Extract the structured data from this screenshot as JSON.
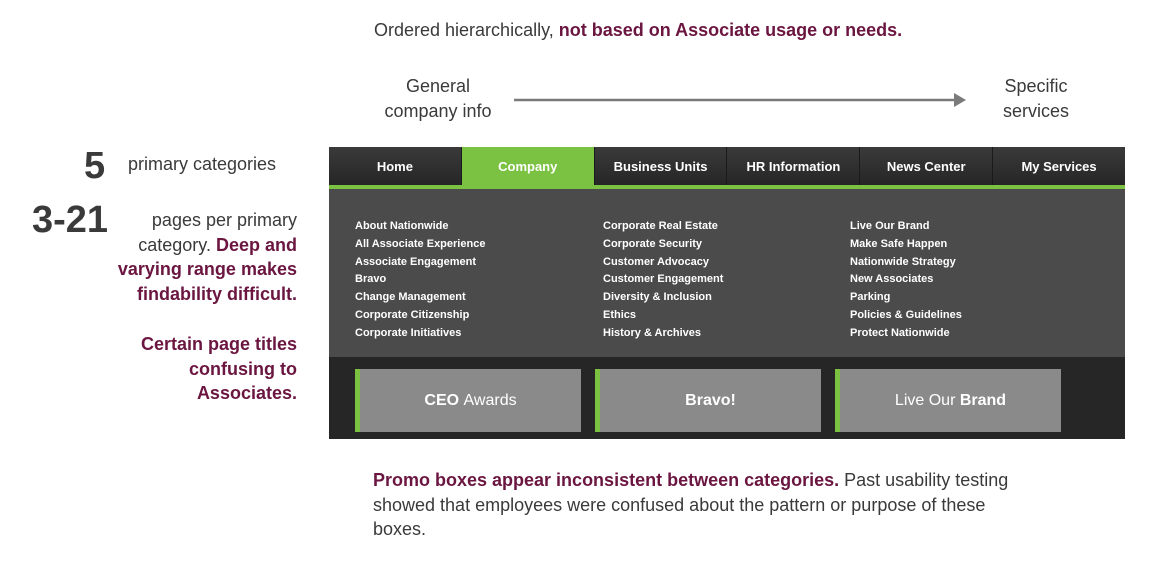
{
  "top_caption": {
    "prefix": "Ordered hierarchically, ",
    "emphasis": "not based on Associate usage or needs."
  },
  "arrow_labels": {
    "start_line1": "General",
    "start_line2": "company info",
    "end_line1": "Specific",
    "end_line2": "services"
  },
  "annotations": {
    "stat_categories_number": "5",
    "stat_categories_text": "primary categories",
    "stat_pages_number": "3-21",
    "stat_pages_text": "pages per primary category. ",
    "stat_pages_emphasis": "Deep and varying range makes findability difficult.",
    "titles_confusing": "Certain page titles confusing to Associates."
  },
  "nav": {
    "tabs": [
      {
        "label": "Home"
      },
      {
        "label": "Company"
      },
      {
        "label": "Business Units"
      },
      {
        "label": "HR Information"
      },
      {
        "label": "News Center"
      },
      {
        "label": "My Services"
      }
    ],
    "active_tab": "Company",
    "menu_columns": [
      [
        "About Nationwide",
        "All Associate Experience",
        "Associate Engagement",
        "Bravo",
        "Change Management",
        "Corporate Citizenship",
        "Corporate Initiatives"
      ],
      [
        "Corporate Real Estate",
        "Corporate Security",
        "Customer Advocacy",
        "Customer Engagement",
        "Diversity & Inclusion",
        "Ethics",
        "History & Archives"
      ],
      [
        "Live Our Brand",
        "Make Safe Happen",
        "Nationwide Strategy",
        "New Associates",
        "Parking",
        "Policies & Guidelines",
        "Protect Nationwide"
      ]
    ],
    "promos": [
      {
        "strong": "CEO",
        "light": "Awards"
      },
      {
        "strong": "Bravo!",
        "light": ""
      },
      {
        "strong": "Brand",
        "light": "Live Our"
      }
    ]
  },
  "bottom_caption": {
    "emphasis": "Promo boxes appear inconsistent between categories.",
    "text": " Past usability testing showed that employees were confused about the pattern or purpose of these boxes."
  },
  "colors": {
    "accent_green": "#7cc242",
    "maroon": "#6b1640",
    "nav_dark": "#2e2e2e",
    "menu_gray": "#4b4b4b"
  }
}
